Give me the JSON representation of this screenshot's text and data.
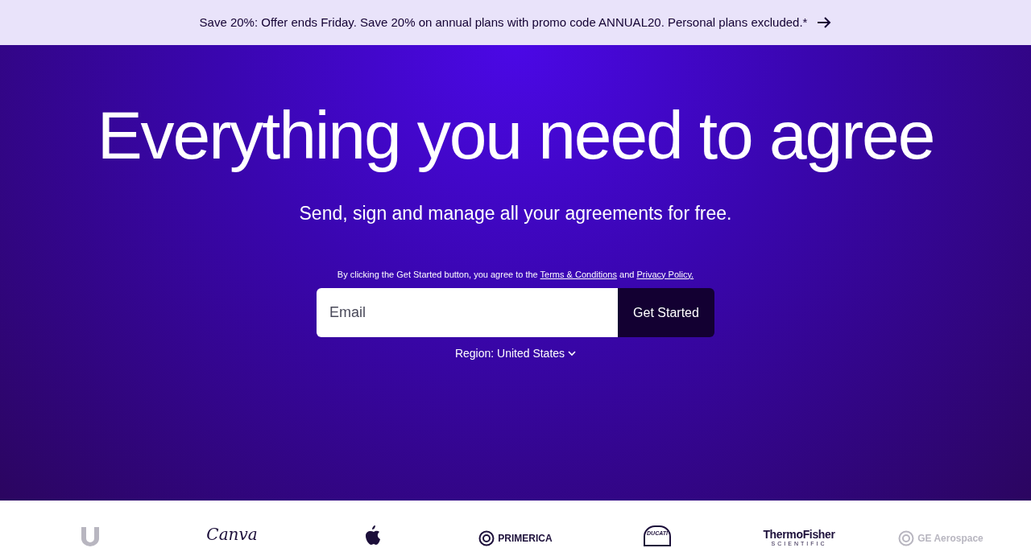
{
  "banner": {
    "text": "Save 20%: Offer ends Friday. Save 20% on annual plans with promo code ANNUAL20. Personal plans excluded.*"
  },
  "hero": {
    "title": "Everything you need to agree",
    "subtitle": "Send, sign and manage all your agreements for free.",
    "consent": {
      "before": "By clicking the Get Started button, you agree to the",
      "terms": "Terms & Conditions",
      "middle": "and",
      "privacy": "Privacy Policy."
    },
    "email": {
      "placeholder": "Email"
    },
    "button": "Get Started",
    "region": "Region: United States"
  },
  "logos": [
    {
      "kind": "u-mark",
      "muted": true
    },
    {
      "kind": "script",
      "text": "Canva",
      "muted": false
    },
    {
      "kind": "fruit",
      "muted": false
    },
    {
      "kind": "emblem",
      "text": "PRIMERICA",
      "muted": false
    },
    {
      "kind": "shield",
      "text": "DUCATI",
      "muted": false
    },
    {
      "kind": "stacked",
      "text": "ThermoFisher",
      "subtext": "SCIENTIFIC",
      "muted": false
    },
    {
      "kind": "emblem",
      "text": "GE Aerospace",
      "muted": true
    }
  ]
}
